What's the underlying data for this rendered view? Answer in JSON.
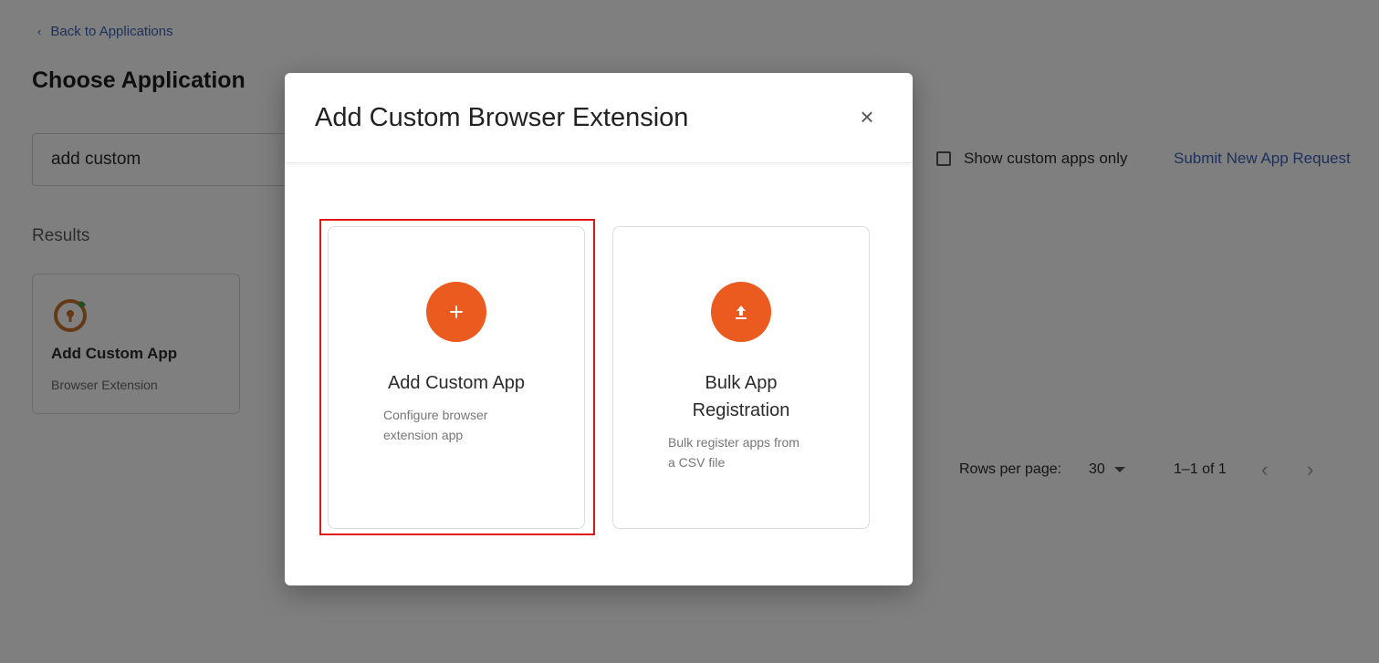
{
  "page": {
    "back_link": "Back to Applications",
    "title": "Choose Application",
    "search_value": "add custom",
    "show_custom_only_label": "Show custom apps only",
    "submit_request_link": "Submit New App Request",
    "results_label": "Results",
    "result_card": {
      "name": "Add Custom App",
      "type": "Browser Extension"
    },
    "pagination": {
      "rows_per_page_label": "Rows per page:",
      "rows_per_page_value": "30",
      "range": "1–1 of 1",
      "prev_icon": "chevron-left-icon",
      "next_icon": "chevron-right-icon"
    }
  },
  "modal": {
    "title": "Add Custom Browser Extension",
    "close_icon": "close-icon",
    "options": [
      {
        "title": "Add Custom App",
        "description_line1": "Configure browser",
        "description_line2": "extension app",
        "icon": "plus-icon"
      },
      {
        "title_line1": "Bulk App",
        "title_line2": "Registration",
        "description_line1": "Bulk register apps from",
        "description_line2": "a CSV file",
        "icon": "upload-icon"
      }
    ]
  },
  "colors": {
    "accent": "#eb5a1e",
    "link": "#3b63b8",
    "highlight": "#e01616"
  }
}
